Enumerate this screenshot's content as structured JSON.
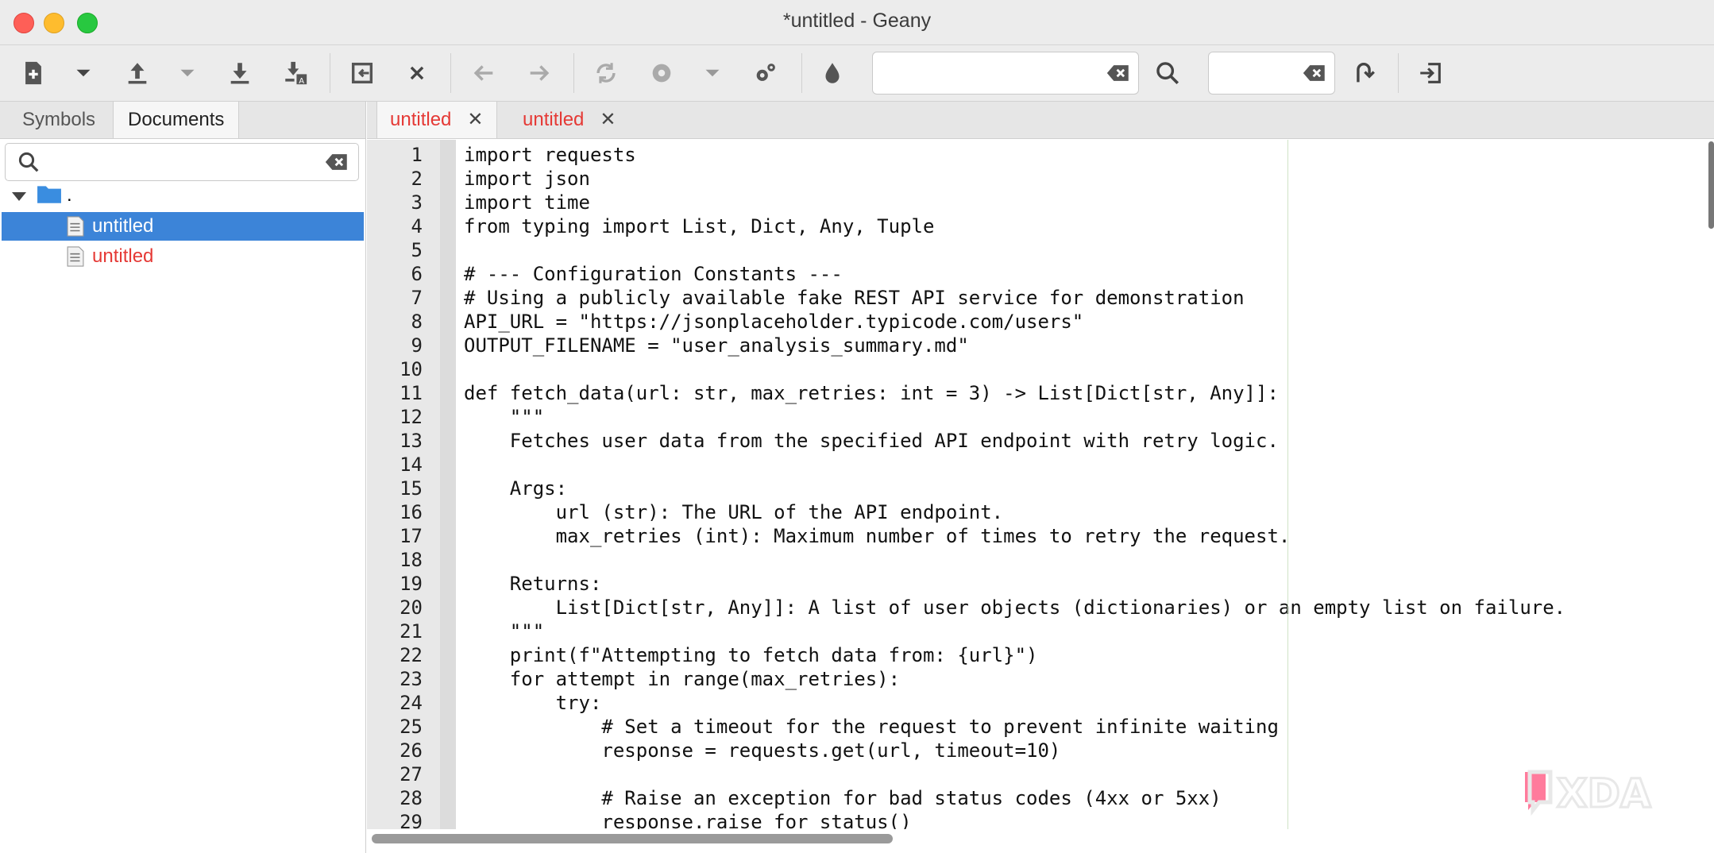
{
  "window": {
    "title": "*untitled - Geany"
  },
  "toolbar": {
    "search_value": "",
    "goto_value": "",
    "icons": [
      "new-file-icon",
      "dropdown-arrow-icon",
      "open-file-icon",
      "recent-files-arrow-icon",
      "save-icon",
      "save-all-icon",
      "revert-icon",
      "close-file-icon",
      "back-arrow-icon",
      "forward-arrow-icon",
      "reload-icon",
      "build-icon",
      "build-dropdown-icon",
      "preferences-icon",
      "color-chooser-icon",
      "clear-search-icon",
      "search-icon",
      "clear-goto-icon",
      "jump-to-line-icon",
      "quit-icon"
    ]
  },
  "sidebar": {
    "tabs": [
      "Symbols",
      "Documents"
    ],
    "active_tab": "Documents",
    "search_value": "",
    "tree": {
      "root_label": ".",
      "files": [
        {
          "label": "untitled",
          "selected": true,
          "modified": false
        },
        {
          "label": "untitled",
          "selected": false,
          "modified": true
        }
      ]
    }
  },
  "editor": {
    "tabs": [
      {
        "label": "untitled",
        "active": true
      },
      {
        "label": "untitled",
        "active": false
      }
    ],
    "line_numbers": [
      "1",
      "2",
      "3",
      "4",
      "5",
      "6",
      "7",
      "8",
      "9",
      "10",
      "11",
      "12",
      "13",
      "14",
      "15",
      "16",
      "17",
      "18",
      "19",
      "20",
      "21",
      "22",
      "23",
      "24",
      "25",
      "26",
      "27",
      "28",
      "29"
    ],
    "lines": [
      "import requests",
      "import json",
      "import time",
      "from typing import List, Dict, Any, Tuple",
      "",
      "# --- Configuration Constants ---",
      "# Using a publicly available fake REST API service for demonstration",
      "API_URL = \"https://jsonplaceholder.typicode.com/users\"",
      "OUTPUT_FILENAME = \"user_analysis_summary.md\"",
      "",
      "def fetch_data(url: str, max_retries: int = 3) -> List[Dict[str, Any]]:",
      "    \"\"\"",
      "    Fetches user data from the specified API endpoint with retry logic.",
      "",
      "    Args:",
      "        url (str): The URL of the API endpoint.",
      "        max_retries (int): Maximum number of times to retry the request.",
      "",
      "    Returns:",
      "        List[Dict[str, Any]]: A list of user objects (dictionaries) or an empty list on failure.",
      "    \"\"\"",
      "    print(f\"Attempting to fetch data from: {url}\")",
      "    for attempt in range(max_retries):",
      "        try:",
      "            # Set a timeout for the request to prevent infinite waiting",
      "            response = requests.get(url, timeout=10)",
      "",
      "            # Raise an exception for bad status codes (4xx or 5xx)",
      "            response.raise_for_status()"
    ]
  },
  "watermark": {
    "text": "XDA"
  },
  "colors": {
    "selection": "#3c84d8",
    "modified_text": "#e53935",
    "gutter": "#e8e8e8"
  }
}
